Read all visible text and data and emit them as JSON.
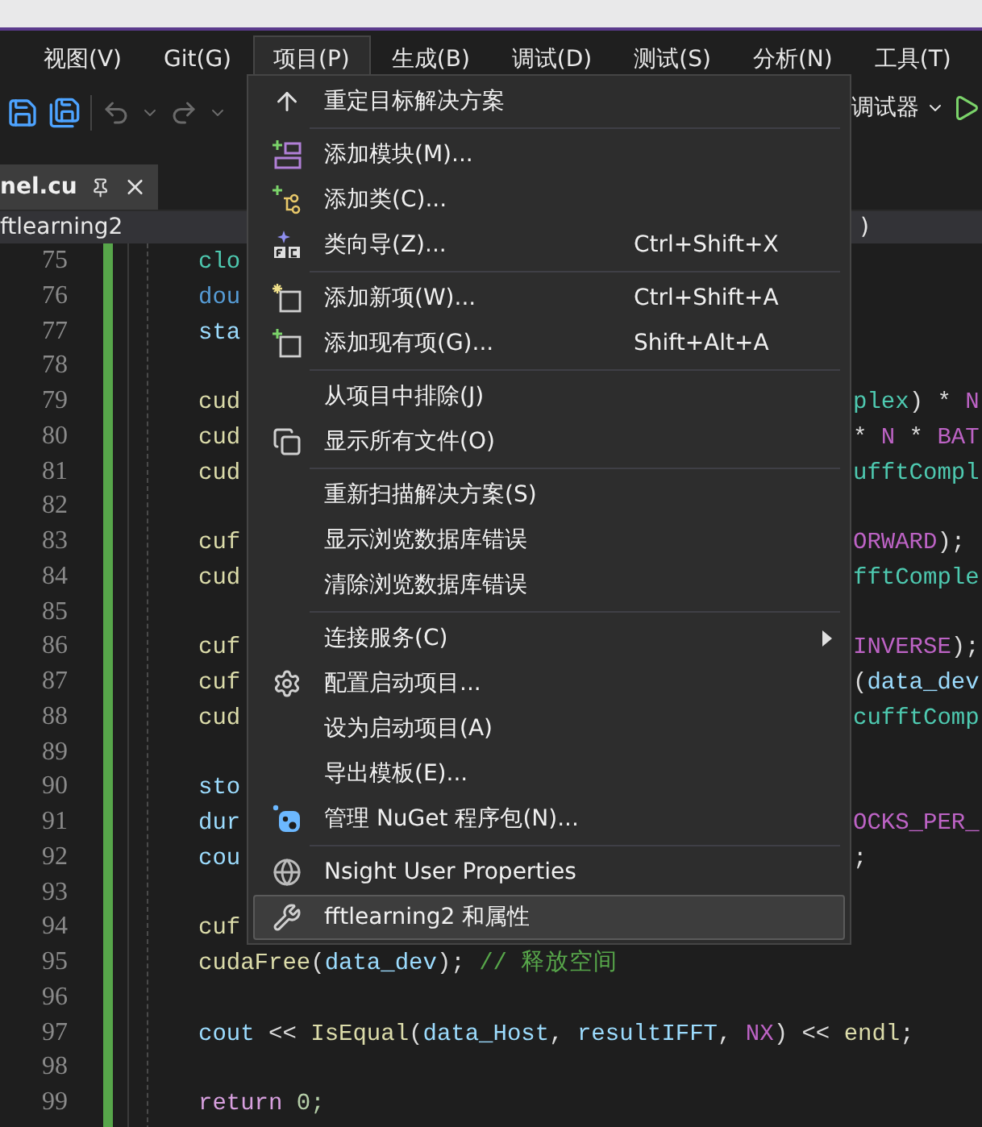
{
  "menubar": [
    {
      "label": "视图(V)",
      "selected": false
    },
    {
      "label": "Git(G)",
      "selected": false
    },
    {
      "label": "项目(P)",
      "selected": true
    },
    {
      "label": "生成(B)",
      "selected": false
    },
    {
      "label": "调试(D)",
      "selected": false
    },
    {
      "label": "测试(S)",
      "selected": false
    },
    {
      "label": "分析(N)",
      "selected": false
    },
    {
      "label": "工具(T)",
      "selected": false
    }
  ],
  "toolbar": {
    "debugger": "调试器"
  },
  "tab": {
    "title": "nel.cu"
  },
  "navbar": {
    "project": "ftlearning2",
    "right": ")"
  },
  "menu": [
    {
      "kind": "item",
      "label": "重定目标解决方案",
      "selected": false
    },
    {
      "kind": "separator"
    },
    {
      "kind": "item",
      "label": "添加模块(M)...",
      "selected": false
    },
    {
      "kind": "item",
      "label": "添加类(C)...",
      "selected": false
    },
    {
      "kind": "item",
      "label": "类向导(Z)...",
      "shortcut": "Ctrl+Shift+X",
      "selected": false
    },
    {
      "kind": "separator"
    },
    {
      "kind": "item",
      "label": "添加新项(W)...",
      "shortcut": "Ctrl+Shift+A",
      "selected": false
    },
    {
      "kind": "item",
      "label": "添加现有项(G)...",
      "shortcut": "Shift+Alt+A",
      "selected": false
    },
    {
      "kind": "separator"
    },
    {
      "kind": "item",
      "label": "从项目中排除(J)",
      "selected": false
    },
    {
      "kind": "item",
      "label": "显示所有文件(O)",
      "selected": false
    },
    {
      "kind": "separator"
    },
    {
      "kind": "item",
      "label": "重新扫描解决方案(S)",
      "selected": false
    },
    {
      "kind": "item",
      "label": "显示浏览数据库错误",
      "selected": false
    },
    {
      "kind": "item",
      "label": "清除浏览数据库错误",
      "selected": false
    },
    {
      "kind": "separator"
    },
    {
      "kind": "item",
      "label": "连接服务(C)",
      "submenu": true,
      "selected": false
    },
    {
      "kind": "item",
      "label": "配置启动项目...",
      "selected": false
    },
    {
      "kind": "item",
      "label": "设为启动项目(A)",
      "selected": false
    },
    {
      "kind": "item",
      "label": "导出模板(E)...",
      "selected": false
    },
    {
      "kind": "item",
      "label": "管理 NuGet 程序包(N)...",
      "selected": false
    },
    {
      "kind": "separator"
    },
    {
      "kind": "item",
      "label": "Nsight User Properties",
      "selected": false
    },
    {
      "kind": "item",
      "label": "fftlearning2 和属性",
      "selected": true
    }
  ],
  "code": [
    {
      "number": "75",
      "left": [
        {
          "text": "clo",
          "kind": "type"
        }
      ]
    },
    {
      "number": "76",
      "left": [
        {
          "text": "dou",
          "kind": "keyword"
        }
      ]
    },
    {
      "number": "77",
      "left": [
        {
          "text": "sta",
          "kind": "var"
        }
      ]
    },
    {
      "number": "78"
    },
    {
      "number": "79",
      "left": [
        {
          "text": "cud",
          "kind": "func"
        }
      ],
      "right": [
        {
          "text": "plex",
          "kind": "type"
        },
        {
          "text": ") * ",
          "kind": "plain"
        },
        {
          "text": "N",
          "kind": "macro"
        }
      ]
    },
    {
      "number": "80",
      "left": [
        {
          "text": "cud",
          "kind": "func"
        }
      ],
      "right": [
        {
          "text": "* ",
          "kind": "plain"
        },
        {
          "text": "N",
          "kind": "macro"
        },
        {
          "text": " * ",
          "kind": "plain"
        },
        {
          "text": "BAT",
          "kind": "macro"
        }
      ]
    },
    {
      "number": "81",
      "left": [
        {
          "text": "cud",
          "kind": "func"
        }
      ],
      "right": [
        {
          "text": "ufftCompl",
          "kind": "type"
        }
      ]
    },
    {
      "number": "82"
    },
    {
      "number": "83",
      "left": [
        {
          "text": "cuf",
          "kind": "func"
        }
      ],
      "right": [
        {
          "text": "ORWARD",
          "kind": "macro"
        },
        {
          "text": ");",
          "kind": "plain"
        }
      ]
    },
    {
      "number": "84",
      "left": [
        {
          "text": "cud",
          "kind": "func"
        }
      ],
      "right": [
        {
          "text": "fftComple",
          "kind": "type"
        }
      ]
    },
    {
      "number": "85"
    },
    {
      "number": "86",
      "left": [
        {
          "text": "cuf",
          "kind": "func"
        }
      ],
      "right": [
        {
          "text": "INVERSE",
          "kind": "macro"
        },
        {
          "text": ");",
          "kind": "plain"
        }
      ]
    },
    {
      "number": "87",
      "left": [
        {
          "text": "cuf",
          "kind": "func"
        }
      ],
      "right": [
        {
          "text": "(",
          "kind": "plain"
        },
        {
          "text": "data_dev",
          "kind": "var"
        }
      ]
    },
    {
      "number": "88",
      "left": [
        {
          "text": "cud",
          "kind": "func"
        }
      ],
      "right": [
        {
          "text": "cufftComp",
          "kind": "type"
        }
      ]
    },
    {
      "number": "89"
    },
    {
      "number": "90",
      "left": [
        {
          "text": "sto",
          "kind": "var"
        }
      ]
    },
    {
      "number": "91",
      "left": [
        {
          "text": "dur",
          "kind": "var"
        }
      ],
      "right": [
        {
          "text": "OCKS_PER_",
          "kind": "macro"
        }
      ]
    },
    {
      "number": "92",
      "left": [
        {
          "text": "cou",
          "kind": "var"
        }
      ],
      "right": [
        {
          "text": ";",
          "kind": "plain"
        }
      ]
    },
    {
      "number": "93"
    },
    {
      "number": "94",
      "left": [
        {
          "text": "cuf",
          "kind": "func"
        }
      ]
    },
    {
      "number": "95",
      "left": [
        {
          "text": "cudaFree",
          "kind": "func"
        },
        {
          "text": "(",
          "kind": "plain"
        },
        {
          "text": "data_dev",
          "kind": "var"
        },
        {
          "text": "); ",
          "kind": "plain"
        },
        {
          "text": "// 释放空间",
          "kind": "comment"
        }
      ]
    },
    {
      "number": "96"
    },
    {
      "number": "97",
      "left": [
        {
          "text": "cout",
          "kind": "var"
        },
        {
          "text": " << ",
          "kind": "plain"
        },
        {
          "text": "IsEqual",
          "kind": "func"
        },
        {
          "text": "(",
          "kind": "plain"
        },
        {
          "text": "data_Host",
          "kind": "var"
        },
        {
          "text": ", ",
          "kind": "plain"
        },
        {
          "text": "resultIFFT",
          "kind": "var"
        },
        {
          "text": ", ",
          "kind": "plain"
        },
        {
          "text": "NX",
          "kind": "macro"
        },
        {
          "text": ") << ",
          "kind": "plain"
        },
        {
          "text": "endl",
          "kind": "func"
        },
        {
          "text": ";",
          "kind": "plain"
        }
      ]
    },
    {
      "number": "98"
    },
    {
      "number": "99",
      "left": [
        {
          "text": "return",
          "kind": "control"
        },
        {
          "text": " 0;",
          "kind": "number"
        }
      ]
    }
  ]
}
